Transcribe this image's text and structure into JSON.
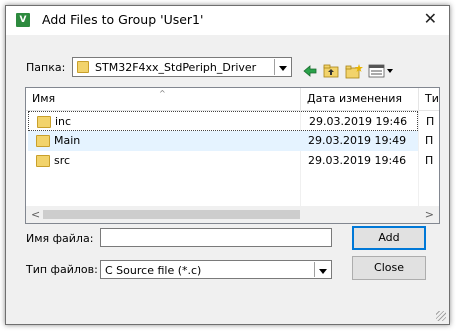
{
  "window": {
    "title": "Add Files to Group 'User1'",
    "close_glyph": "✕",
    "icon_letter": "V"
  },
  "lookin": {
    "label": "Папка:",
    "value": "STM32F4xx_StdPeriph_Driver"
  },
  "toolbar": {
    "icons": [
      "back-icon",
      "up-folder-icon",
      "new-folder-icon",
      "view-menu-icon"
    ]
  },
  "columns": [
    {
      "label": "Имя"
    },
    {
      "label": "Дата изменения"
    },
    {
      "label": "Ти"
    }
  ],
  "files": [
    {
      "name": "inc",
      "date": "29.03.2019 19:46",
      "type": "П"
    },
    {
      "name": "Main",
      "date": "29.03.2019 19:49",
      "type": "П"
    },
    {
      "name": "src",
      "date": "29.03.2019 19:46",
      "type": "П"
    }
  ],
  "filename": {
    "label": "Имя файла:",
    "value": ""
  },
  "filetype": {
    "label": "Тип файлов:",
    "value": "C Source file (*.c)"
  },
  "buttons": {
    "add": "Add",
    "close": "Close"
  },
  "colors": {
    "accent": "#0078d7",
    "folder": "#f2d36b",
    "selection": "#e5f3ff"
  }
}
